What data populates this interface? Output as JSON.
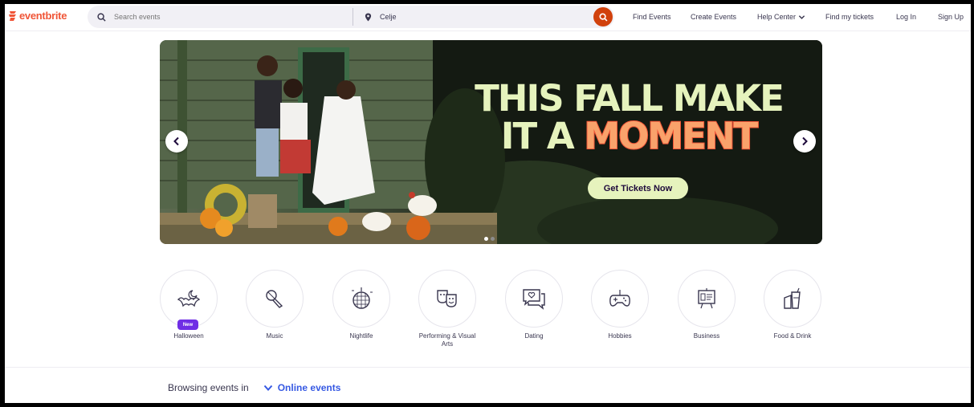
{
  "header": {
    "logo": "eventbrite",
    "search_placeholder": "Search events",
    "location_value": "Celje",
    "nav": [
      "Find Events",
      "Create Events",
      "Help Center",
      "Find my tickets",
      "Log In",
      "Sign Up"
    ]
  },
  "hero": {
    "line1": "THIS FALL MAKE",
    "line2_prefix": "IT A ",
    "line2_highlight": "MOMENT",
    "cta": "Get Tickets Now",
    "slides": 2,
    "active_slide": 1
  },
  "categories": [
    {
      "label": "Halloween",
      "badge": "New",
      "icon": "halloween-bat-icon"
    },
    {
      "label": "Music",
      "icon": "microphone-icon"
    },
    {
      "label": "Nightlife",
      "icon": "disco-ball-icon"
    },
    {
      "label": "Performing & Visual Arts",
      "icon": "theater-masks-icon"
    },
    {
      "label": "Dating",
      "icon": "chat-heart-icon"
    },
    {
      "label": "Hobbies",
      "icon": "gamepad-icon"
    },
    {
      "label": "Business",
      "icon": "presentation-board-icon"
    },
    {
      "label": "Food & Drink",
      "icon": "food-drink-icon"
    }
  ],
  "browsing": {
    "label": "Browsing events in",
    "location": "Online events"
  },
  "colors": {
    "brand": "#f05537",
    "search_button": "#d1410c",
    "hero_text": "#e6f3bd",
    "link_blue": "#3659e3",
    "badge_purple": "#6f2ee5"
  }
}
